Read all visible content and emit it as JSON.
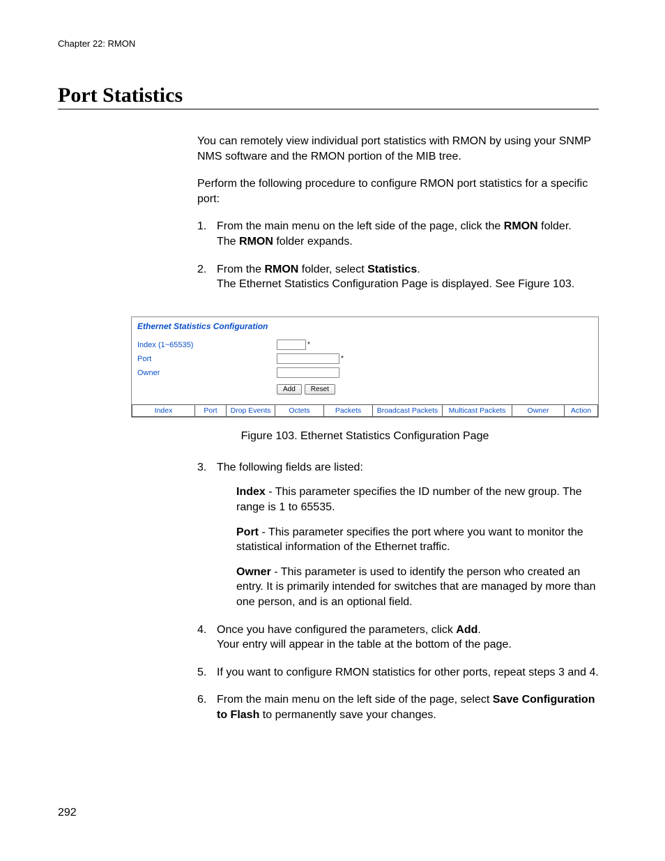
{
  "header": {
    "chapter_line": "Chapter 22: RMON"
  },
  "title": "Port Statistics",
  "intro": {
    "p1": "You can remotely view individual port statistics with RMON by using your SNMP NMS software and the RMON portion of the MIB tree.",
    "p2": "Perform the following procedure to configure RMON port statistics for a specific port:"
  },
  "steps": {
    "s1": {
      "num": "1.",
      "line_a_pre": "From the main menu on the left side of the page, click the ",
      "line_a_bold": "RMON",
      "line_a_post": " folder.",
      "line_b_pre": "The ",
      "line_b_bold": "RMON",
      "line_b_post": " folder expands."
    },
    "s2": {
      "num": "2.",
      "line_a_pre": "From the ",
      "line_a_bold1": "RMON",
      "line_a_mid": " folder, select ",
      "line_a_bold2": "Statistics",
      "line_a_post": ".",
      "line_b": "The Ethernet Statistics Configuration Page is displayed. See Figure 103."
    },
    "s3": {
      "num": "3.",
      "lead": "The following fields are listed:",
      "field_index_label": "Index",
      "field_index_text": " - This parameter specifies the ID number of the new group. The range is 1 to 65535.",
      "field_port_label": "Port",
      "field_port_text": " - This parameter specifies the port where you want to monitor the statistical information of the Ethernet traffic.",
      "field_owner_label": "Owner",
      "field_owner_text": " - This parameter is used to identify the person who created an entry. It is primarily intended for switches that are managed by more than one person, and is an optional field."
    },
    "s4": {
      "num": "4.",
      "line_a_pre": "Once you have configured the parameters, click ",
      "line_a_bold": "Add",
      "line_a_post": ".",
      "line_b": "Your entry will appear in the table at the bottom of the page."
    },
    "s5": {
      "num": "5.",
      "text": "If you want to configure RMON statistics for other ports, repeat steps 3 and 4."
    },
    "s6": {
      "num": "6.",
      "line_a_pre": "From the main menu on the left side of the page, select ",
      "line_a_bold": "Save Configuration to Flash",
      "line_a_post": " to permanently save your changes."
    }
  },
  "figure": {
    "title": "Ethernet Statistics Configuration",
    "form": {
      "index_label": "Index (1~65535)",
      "port_label": "Port",
      "owner_label": "Owner",
      "star": "*",
      "add_btn": "Add",
      "reset_btn": "Reset"
    },
    "grid": {
      "index": "Index",
      "port": "Port",
      "drop": "Drop Events",
      "octets": "Octets",
      "packets": "Packets",
      "bcast": "Broadcast Packets",
      "mcast": "Multicast Packets",
      "owner": "Owner",
      "action": "Action"
    },
    "caption": "Figure 103. Ethernet Statistics Configuration Page"
  },
  "page_number": "292"
}
